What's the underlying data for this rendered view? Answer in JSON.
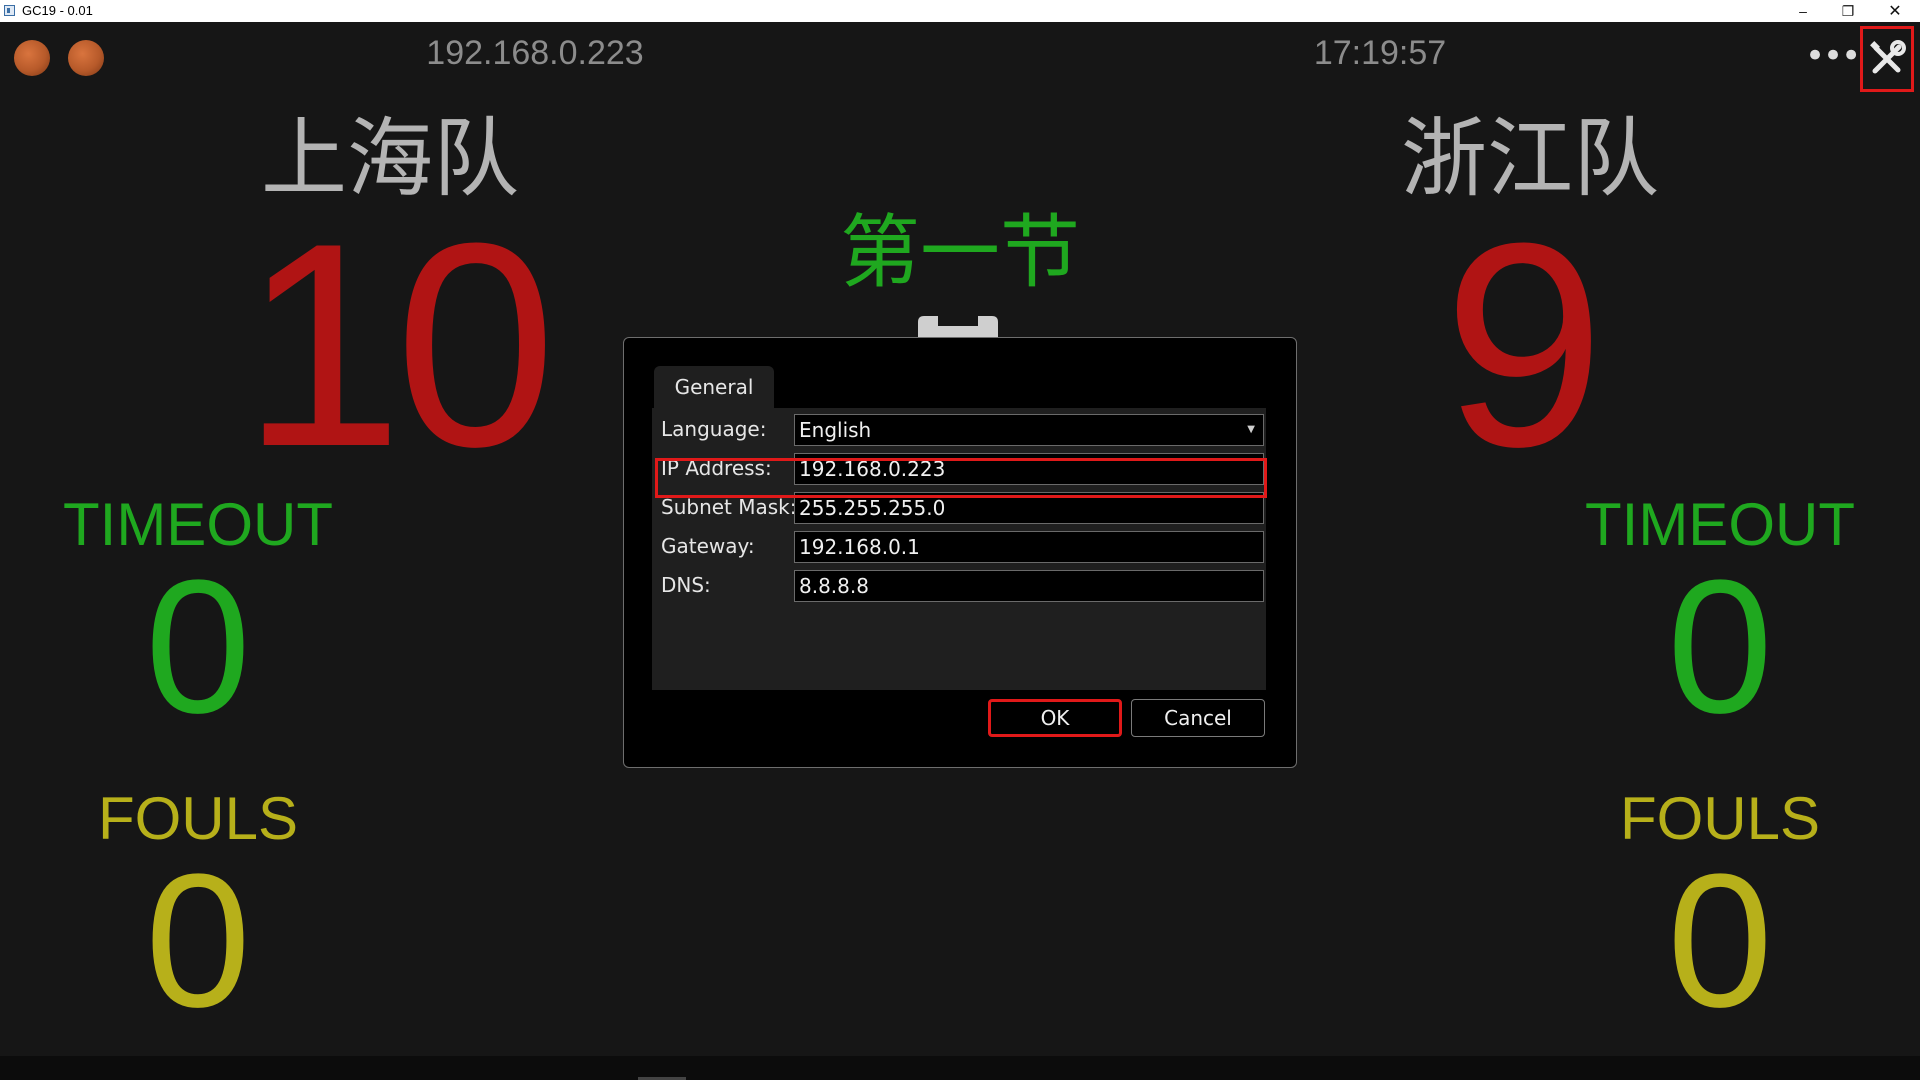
{
  "window": {
    "title": "GC19 - 0.01",
    "minimize_label": "–",
    "maximize_label": "❐",
    "close_label": "✕"
  },
  "header": {
    "ip": "192.168.0.223",
    "time": "17:19:57",
    "more_label": "•••"
  },
  "home": {
    "name": "上海队",
    "score": "10",
    "timeout_label": "TIMEOUT",
    "timeouts": "0",
    "fouls_label": "FOULS",
    "fouls": "0"
  },
  "away": {
    "name": "浙江队",
    "score": "9",
    "timeout_label": "TIMEOUT",
    "timeouts": "0",
    "fouls_label": "FOULS",
    "fouls": "0"
  },
  "period": "第一节",
  "dialog": {
    "tab": "General",
    "language": {
      "label": "Language:",
      "value": "English"
    },
    "ip_address": {
      "label": "IP Address:",
      "value": "192.168.0.223"
    },
    "subnet_mask": {
      "label": "Subnet Mask:",
      "value": "255.255.255.0"
    },
    "gateway": {
      "label": "Gateway:",
      "value": "192.168.0.1"
    },
    "dns": {
      "label": "DNS:",
      "value": "8.8.8.8"
    },
    "ok_label": "OK",
    "cancel_label": "Cancel"
  },
  "colors": {
    "background": "#161616",
    "score": "#b01414",
    "timeout": "#1fa81f",
    "fouls": "#b7b01a",
    "team_name": "#b4b4b4",
    "highlight": "#e01919"
  }
}
